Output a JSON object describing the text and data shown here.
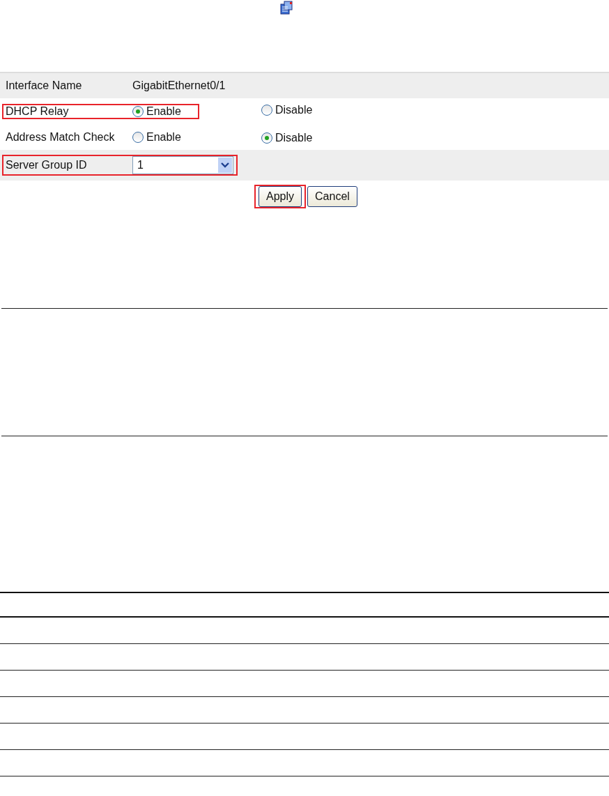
{
  "form": {
    "rows": [
      {
        "kind": "text",
        "label": "Interface Name",
        "value": "GigabitEthernet0/1",
        "highlighted": false
      },
      {
        "kind": "radio",
        "label": "DHCP Relay",
        "options": [
          {
            "label": "Enable",
            "selected": true
          },
          {
            "label": "Disable",
            "selected": false
          }
        ],
        "highlighted": true
      },
      {
        "kind": "radio",
        "label": "Address Match Check",
        "options": [
          {
            "label": "Enable",
            "selected": false
          },
          {
            "label": "Disable",
            "selected": true
          }
        ],
        "highlighted": false
      },
      {
        "kind": "select",
        "label": "Server Group ID",
        "value": "1",
        "highlighted": true
      }
    ],
    "buttons": [
      {
        "label": "Apply",
        "highlighted": true
      },
      {
        "label": "Cancel",
        "highlighted": false
      }
    ]
  }
}
